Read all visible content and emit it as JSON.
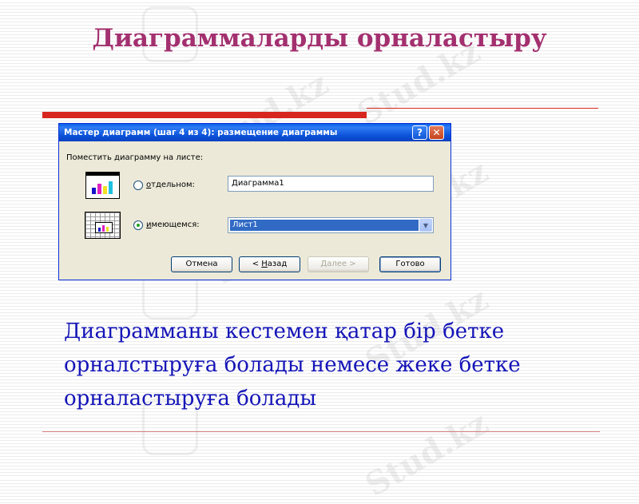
{
  "slide": {
    "title": "Диаграммаларды орналастыру",
    "body_text": "Диаграмманы кестемен қатар бір бетке орналстыруға болады немесе жеке бетке орналастыруға болады",
    "watermark": "Stud.kz"
  },
  "dialog": {
    "title": "Мастер диаграмм (шаг 4 из 4): размещение диаграммы",
    "help_glyph": "?",
    "close_glyph": "✕",
    "group_label": "Поместить диаграмму на листе:",
    "option_separate": {
      "underlined": "о",
      "rest": "тдельном:",
      "selected": false
    },
    "option_existing": {
      "underlined": "и",
      "rest": "меющемся:",
      "selected": true
    },
    "separate_name_value": "Диаграмма1",
    "existing_sheet_value": "Лист1",
    "buttons": {
      "cancel": "Отмена",
      "back_prefix": "< ",
      "back_underlined": "Н",
      "back_rest": "азад",
      "next": "Далее >",
      "finish": "Готово"
    }
  },
  "colors": {
    "title": "#a3306f",
    "body_text": "#1414b8",
    "accent_bar": "#d7261e",
    "xp_titlebar": "#0a50d8"
  },
  "icons": {
    "separate_sheet": "chart-sheet-icon",
    "existing_sheet": "embedded-chart-icon",
    "dropdown": "chevron-down-icon"
  }
}
